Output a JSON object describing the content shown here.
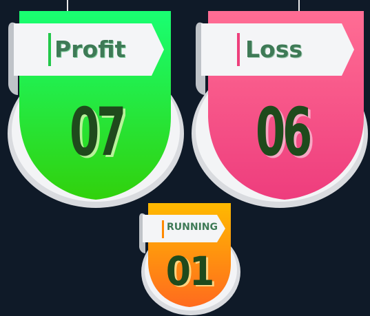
{
  "cards": {
    "profit": {
      "label": "Profit",
      "value": "07",
      "color_top": "#1dff6a",
      "color_bottom": "#2ed20f",
      "accent": "#22c84a"
    },
    "loss": {
      "label": "Loss",
      "value": "06",
      "color_top": "#ff6a93",
      "color_bottom": "#ef3f7f",
      "accent": "#ee3f7c"
    },
    "running": {
      "label": "RUNNING",
      "value": "01",
      "color_top": "#ffb600",
      "color_bottom": "#ff6f1d",
      "accent": "#ff8a00"
    }
  }
}
